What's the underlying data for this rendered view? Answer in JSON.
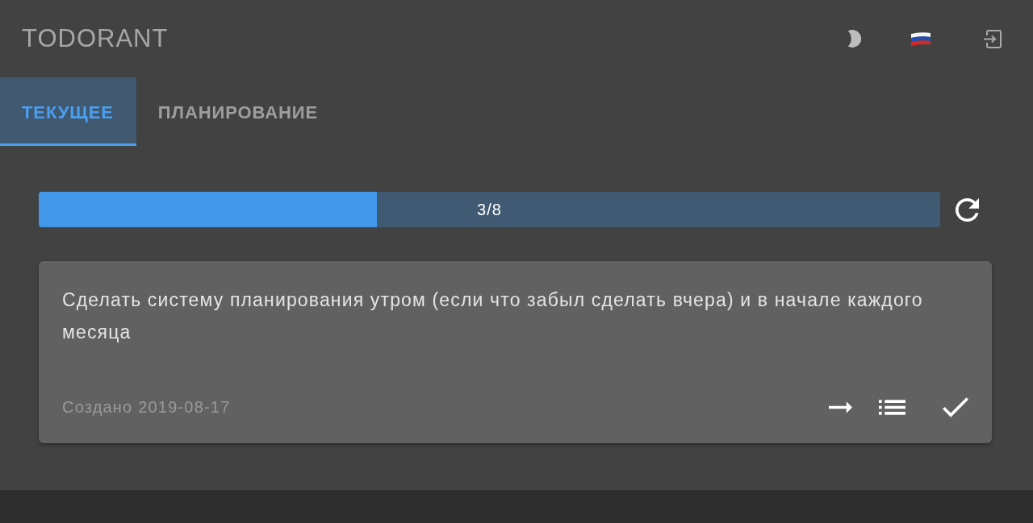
{
  "header": {
    "title": "TODORANT"
  },
  "tabs": [
    {
      "label": "ТЕКУЩЕЕ",
      "selected": true
    },
    {
      "label": "ПЛАНИРОВАНИЕ",
      "selected": false
    }
  ],
  "progress": {
    "level": 0.375,
    "reading": "3/8"
  },
  "todos": [
    {
      "text": "Сделать систему планирования утром (если что забыл сделать вчера) и в начале каждого месяца",
      "created": "Создано 2019-08-17"
    }
  ]
}
